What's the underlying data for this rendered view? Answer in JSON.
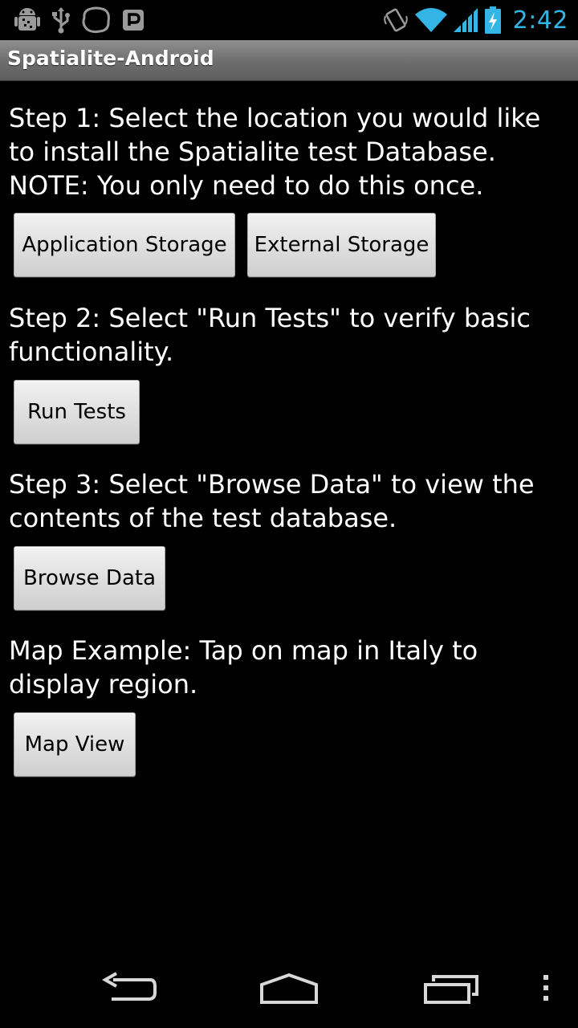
{
  "status_bar": {
    "left_icons": [
      "android-debug-icon",
      "usb-icon",
      "notification-blob-icon",
      "parking-p-icon"
    ],
    "right_icons": [
      "vibrate-icon",
      "wifi-icon",
      "cell-signal-icon",
      "battery-charging-icon"
    ],
    "time": "2:42",
    "time_color": "#33b5e5"
  },
  "app": {
    "title": "Spatialite-Android"
  },
  "steps": {
    "step1_text": "Step 1: Select the location you would like to install the Spatialite test Database.\nNOTE: You only need to do this once.",
    "application_storage_label": "Application Storage",
    "external_storage_label": "External Storage",
    "step2_text": "Step 2: Select \"Run Tests\" to verify basic functionality.",
    "run_tests_label": "Run Tests",
    "step3_text": "Step 3: Select \"Browse Data\" to view the contents of the test database.",
    "browse_data_label": "Browse Data",
    "map_text": "Map Example: Tap on map in Italy to display region.",
    "map_view_label": "Map View"
  },
  "nav_bar": {
    "buttons": [
      "back-icon",
      "home-icon",
      "recent-apps-icon",
      "menu-overflow-icon"
    ]
  }
}
